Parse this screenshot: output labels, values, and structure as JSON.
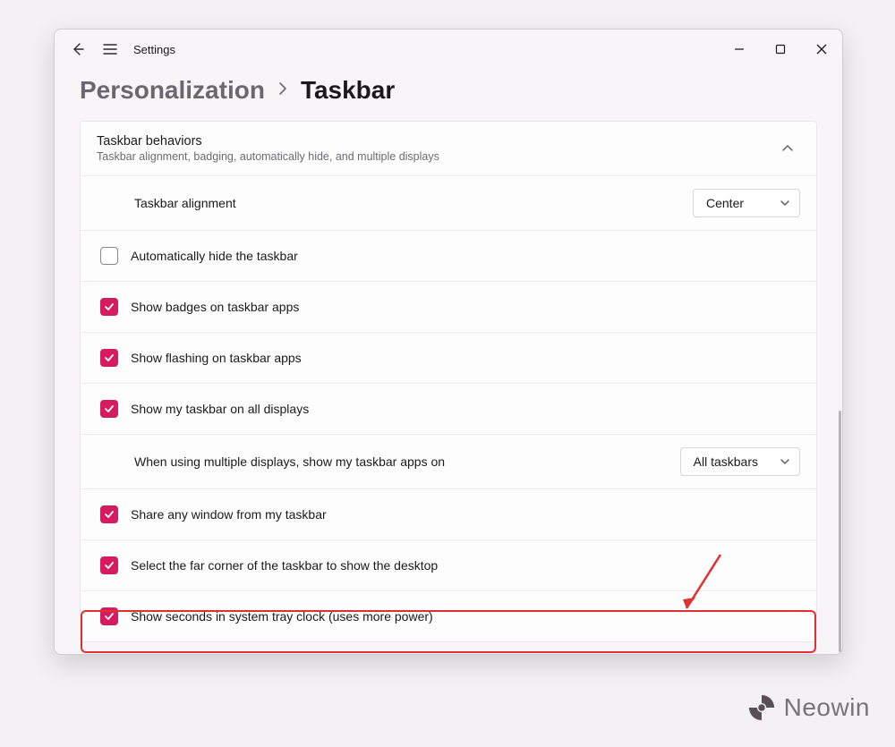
{
  "app": {
    "title": "Settings"
  },
  "breadcrumb": {
    "parent": "Personalization",
    "current": "Taskbar"
  },
  "card": {
    "title": "Taskbar behaviors",
    "subtitle": "Taskbar alignment, badging, automatically hide, and multiple displays"
  },
  "rows": {
    "alignment": {
      "label": "Taskbar alignment",
      "value": "Center"
    },
    "autohide": {
      "label": "Automatically hide the taskbar",
      "checked": false
    },
    "badges": {
      "label": "Show badges on taskbar apps",
      "checked": true
    },
    "flashing": {
      "label": "Show flashing on taskbar apps",
      "checked": true
    },
    "alldisp": {
      "label": "Show my taskbar on all displays",
      "checked": true
    },
    "multdisp": {
      "label": "When using multiple displays, show my taskbar apps on",
      "value": "All taskbars"
    },
    "share": {
      "label": "Share any window from my taskbar",
      "checked": true
    },
    "corner": {
      "label": "Select the far corner of the taskbar to show the desktop",
      "checked": true
    },
    "seconds": {
      "label": "Show seconds in system tray clock (uses more power)",
      "checked": true
    }
  },
  "watermark": {
    "text": "Neowin"
  },
  "accent": "#d61b60",
  "annotation_color": "#e03030"
}
